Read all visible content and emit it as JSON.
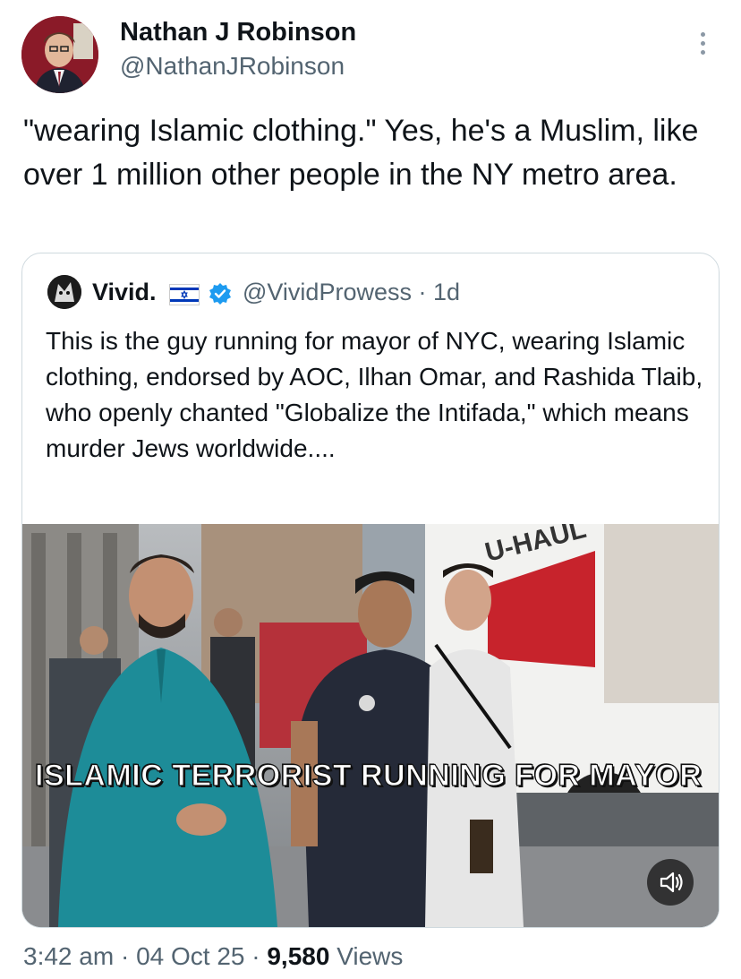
{
  "author": {
    "name": "Nathan J Robinson",
    "handle": "@NathanJRobinson"
  },
  "tweet": {
    "text": "\"wearing Islamic clothing.\" Yes, he's a Muslim, like over 1 million other people in the NY metro area."
  },
  "quoted_tweet": {
    "name": "Vivid.",
    "handle": "@VividProwess",
    "age": "1d",
    "text": "This is the guy running for mayor of NYC, wearing Islamic clothing, endorsed by AOC, Ilhan Omar, and Rashida Tlaib, who openly chanted \"Globalize the Intifada,\" which means murder Jews worldwide....",
    "media": {
      "caption": "ISLAMIC TERRORIST RUNNING FOR MAYOR",
      "truck_text": "U-HAUL",
      "mute_icon": "speaker-icon"
    }
  },
  "meta": {
    "time": "3:42 am",
    "date": "04 Oct 25",
    "views_count": "9,580",
    "views_label": "Views",
    "separator": "·"
  },
  "colors": {
    "text": "#0f1419",
    "secondary": "#536471",
    "border": "#cfd9de",
    "verified": "#1d9bf0"
  }
}
